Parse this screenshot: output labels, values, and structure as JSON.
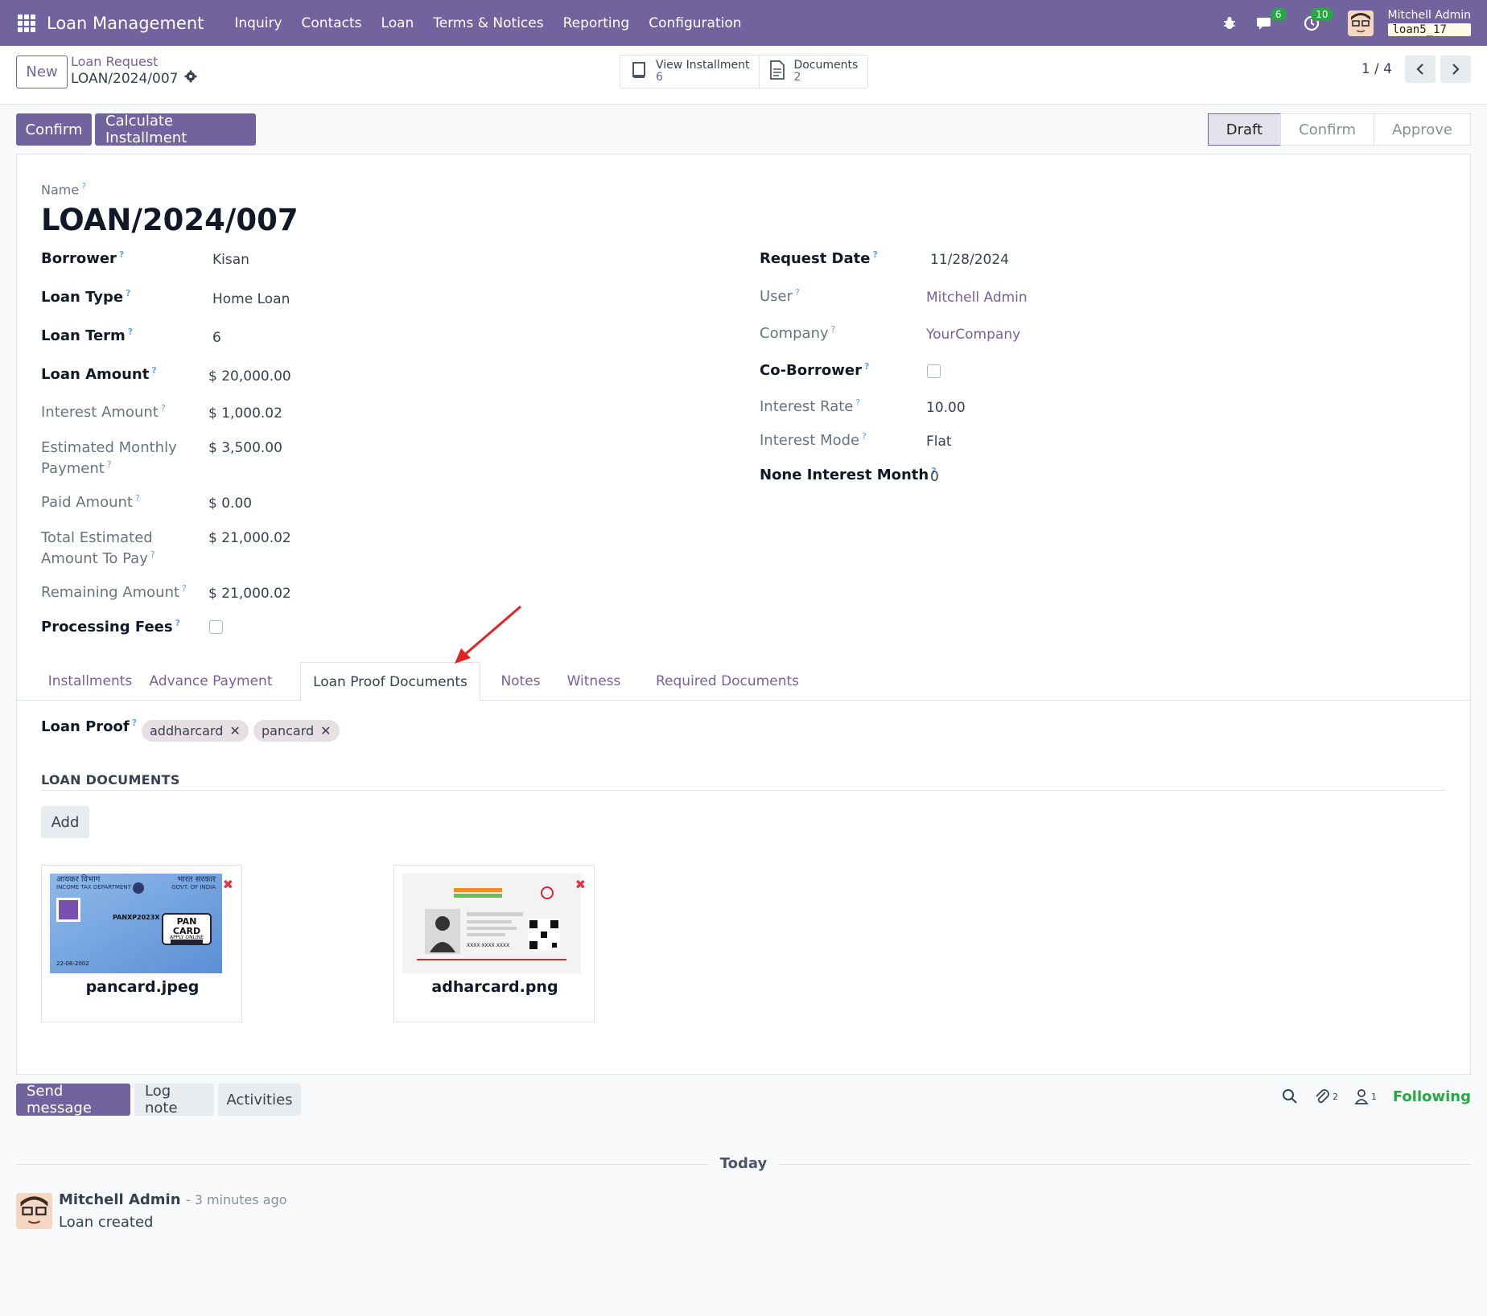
{
  "nav": {
    "brand": "Loan Management",
    "menu": [
      "Inquiry",
      "Contacts",
      "Loan",
      "Terms & Notices",
      "Reporting",
      "Configuration"
    ],
    "chat_count": "6",
    "activity_count": "10",
    "user_name": "Mitchell Admin",
    "db_name": "loan5_17"
  },
  "control": {
    "new_label": "New",
    "breadcrumb_parent": "Loan Request",
    "breadcrumb_current": "LOAN/2024/007",
    "smart_buttons": [
      {
        "label": "View Installment",
        "count": "6"
      },
      {
        "label": "Documents",
        "count": "2"
      }
    ],
    "pager": "1 / 4"
  },
  "actions": {
    "confirm": "Confirm",
    "calculate": "Calculate Installment"
  },
  "statusbar": [
    "Draft",
    "Confirm",
    "Approve"
  ],
  "form": {
    "name_label": "Name",
    "name": "LOAN/2024/007",
    "left": [
      {
        "label": "Borrower",
        "value": "Kisan"
      },
      {
        "label": "Loan Type",
        "value": "Home Loan"
      },
      {
        "label": "Loan Term",
        "value": "6"
      },
      {
        "label": "Loan Amount",
        "value": "$ 20,000.00"
      },
      {
        "label": "Interest Amount",
        "value": "$ 1,000.02"
      },
      {
        "label_line1": "Estimated Monthly",
        "label_line2": "Payment",
        "value": "$ 3,500.00"
      },
      {
        "label": "Paid Amount",
        "value": "$ 0.00"
      },
      {
        "label_line1": "Total Estimated",
        "label_line2": "Amount To Pay",
        "value": "$ 21,000.02"
      },
      {
        "label": "Remaining Amount",
        "value": "$ 21,000.02"
      },
      {
        "label": "Processing Fees",
        "value": ""
      }
    ],
    "right": [
      {
        "label": "Request Date",
        "value": "11/28/2024"
      },
      {
        "label": "User",
        "value": "Mitchell Admin"
      },
      {
        "label": "Company",
        "value": "YourCompany"
      },
      {
        "label": "Co-Borrower",
        "value": ""
      },
      {
        "label": "Interest Rate",
        "value": "10.00"
      },
      {
        "label": "Interest Mode",
        "value": "Flat"
      },
      {
        "label": "None Interest Month",
        "value": "0"
      }
    ]
  },
  "tabs": [
    "Installments",
    "Advance Payment",
    "Loan Proof Documents",
    "Notes",
    "Witness",
    "Required Documents"
  ],
  "loan_proof": {
    "label": "Loan Proof",
    "tags": [
      "addharcard",
      "pancard"
    ]
  },
  "documents": {
    "section_title": "LOAN DOCUMENTS",
    "add_label": "Add",
    "files": [
      {
        "name": "pancard.jpeg"
      },
      {
        "name": "adharcard.png"
      }
    ],
    "pan_card_text": {
      "left_header_1": "आयकर विभाग",
      "left_header_2": "INCOME TAX DEPARTMENT",
      "right_header_1": "भारत सरकार",
      "right_header_2": "GOVT. OF INDIA",
      "card_title": "PAN CARD",
      "card_subtitle": "APPLY ONLINE",
      "pan_number": "PANXP2023X",
      "date": "22-08-2002"
    },
    "aadhaar_text": {
      "number": "XXXX XXXX XXXX"
    }
  },
  "chatter": {
    "send_message": "Send message",
    "log_note": "Log note",
    "activities": "Activities",
    "attachments_count": "2",
    "followers_count": "1",
    "following": "Following",
    "today": "Today",
    "author": "Mitchell Admin",
    "time": "- 3 minutes ago",
    "body": "Loan created"
  },
  "colors": {
    "brand": "#71639e",
    "success": "#28a745",
    "danger": "#dc3545"
  }
}
